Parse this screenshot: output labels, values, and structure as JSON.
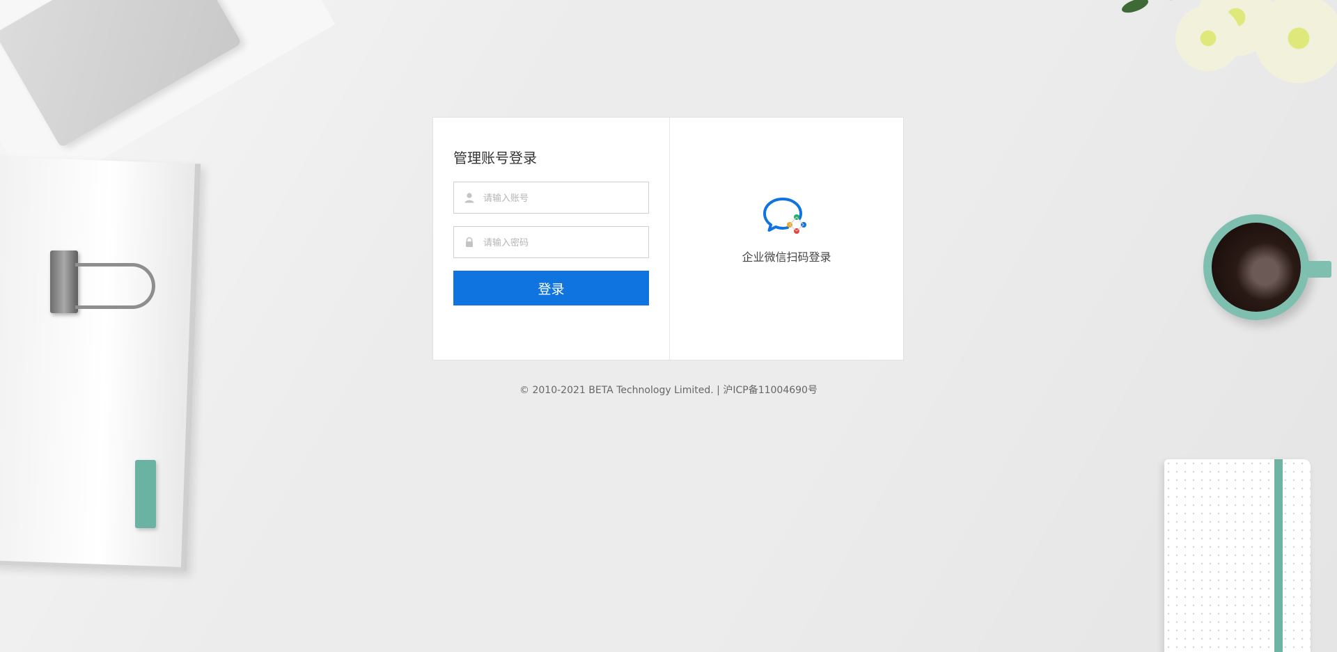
{
  "login": {
    "title": "管理账号登录",
    "username_placeholder": "请输入账号",
    "password_placeholder": "请输入密码",
    "submit_label": "登录"
  },
  "wechat_work": {
    "label": "企业微信扫码登录",
    "icon": "wework-logo-icon"
  },
  "footer": {
    "copyright": "© 2010-2021 BETA Technology Limited. | 沪ICP备11004690号"
  },
  "colors": {
    "primary": "#0f74e0",
    "background": "#ececec"
  }
}
